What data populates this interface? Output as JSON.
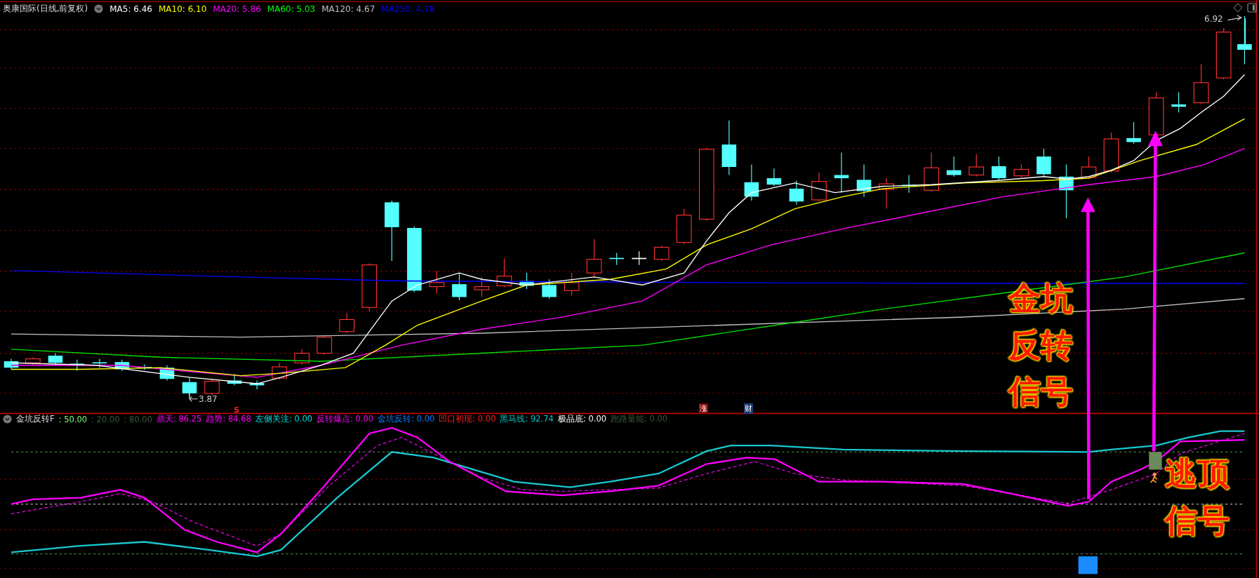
{
  "chart_title": "奥康国际(日线,前复权)",
  "ma_legend": [
    {
      "label": "MA5: 6.46",
      "color": "#ffffff"
    },
    {
      "label": "MA10: 6.10",
      "color": "#ffff00"
    },
    {
      "label": "MA20: 5.86",
      "color": "#ff00ff"
    },
    {
      "label": "MA60: 5.03",
      "color": "#00ff00"
    },
    {
      "label": "MA120: 4.67",
      "color": "#c0c0c0"
    },
    {
      "label": "MA250: 4.78",
      "color": "#0000ff"
    }
  ],
  "price_high": "6.92",
  "price_low": "3.87",
  "event_markers": [
    {
      "text": "S",
      "kind": "signal"
    },
    {
      "text": "涨",
      "kind": "badge",
      "color": "#8b0000"
    },
    {
      "text": "财",
      "kind": "badge",
      "color": "#1c3a6e"
    }
  ],
  "annotations": [
    {
      "text": "金坑反转信号"
    },
    {
      "text": "逃顶信号"
    }
  ],
  "indicator_title": "金坑反转F",
  "indicator_legend": [
    {
      "label": ": 50.00",
      "color": "#80ff80"
    },
    {
      "label": ": 20.00",
      "color": "#3a5a3a"
    },
    {
      "label": ": 80.00",
      "color": "#3a5a3a"
    },
    {
      "label": "鼎天: 86.25",
      "color": "#ff00ff"
    },
    {
      "label": "趋势: 84.68",
      "color": "#ff00ff"
    },
    {
      "label": "左侧关注: 0.00",
      "color": "#00e0e0"
    },
    {
      "label": "反转爆点: 0.00",
      "color": "#ff00ff"
    },
    {
      "label": "金坑反转: 0.00",
      "color": "#0080ff"
    },
    {
      "label": "凹口初现: 0.00",
      "color": "#ff2020"
    },
    {
      "label": "黑马线: 92.74",
      "color": "#00c8c8"
    },
    {
      "label": "极品底: 0.00",
      "color": "#ffffff"
    },
    {
      "label": "跑路量能: 0.00",
      "color": "#3a5a3a"
    }
  ]
}
